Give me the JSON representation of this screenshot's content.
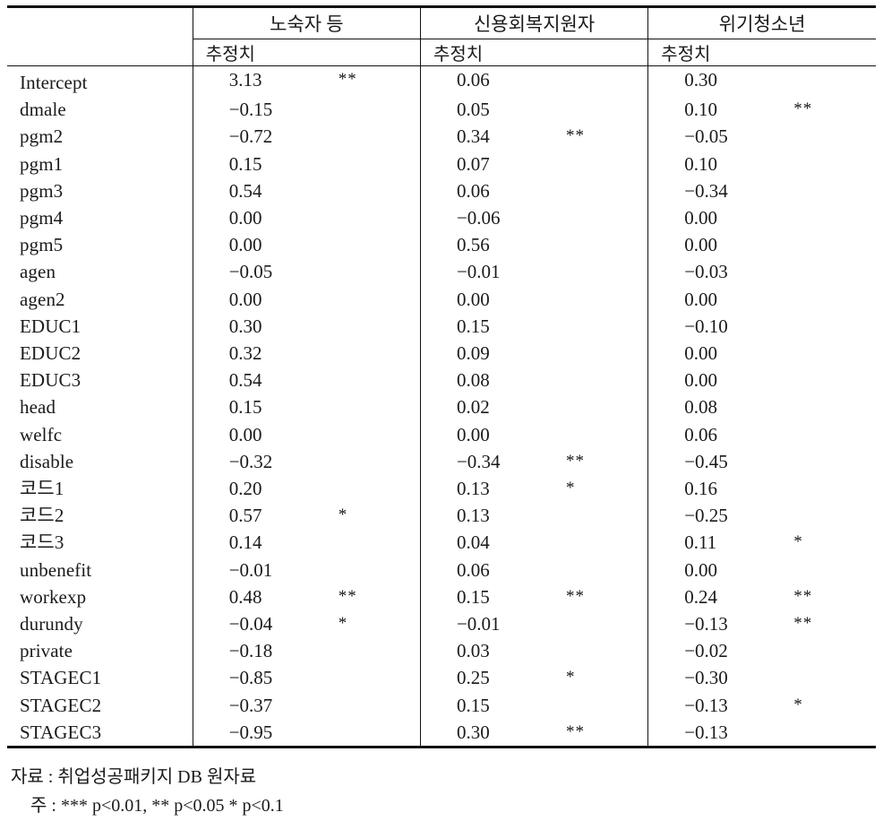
{
  "table": {
    "variable_header": "",
    "groups": [
      {
        "label": "노숙자 등",
        "sub_label": "추정치"
      },
      {
        "label": "신용회복지원자",
        "sub_label": "추정치"
      },
      {
        "label": "위기청소년",
        "sub_label": "추정치"
      }
    ],
    "rows": [
      {
        "variable": "Intercept",
        "c0": "3.13",
        "s0": "**",
        "c1": "0.06",
        "s1": "",
        "c2": "0.30",
        "s2": ""
      },
      {
        "variable": "dmale",
        "c0": "−0.15",
        "s0": "",
        "c1": "0.05",
        "s1": "",
        "c2": "0.10",
        "s2": "**"
      },
      {
        "variable": "pgm2",
        "c0": "−0.72",
        "s0": "",
        "c1": "0.34",
        "s1": "**",
        "c2": "−0.05",
        "s2": ""
      },
      {
        "variable": "pgm1",
        "c0": "0.15",
        "s0": "",
        "c1": "0.07",
        "s1": "",
        "c2": "0.10",
        "s2": ""
      },
      {
        "variable": "pgm3",
        "c0": "0.54",
        "s0": "",
        "c1": "0.06",
        "s1": "",
        "c2": "−0.34",
        "s2": ""
      },
      {
        "variable": "pgm4",
        "c0": "0.00",
        "s0": "",
        "c1": "−0.06",
        "s1": "",
        "c2": "0.00",
        "s2": ""
      },
      {
        "variable": "pgm5",
        "c0": "0.00",
        "s0": "",
        "c1": "0.56",
        "s1": "",
        "c2": "0.00",
        "s2": ""
      },
      {
        "variable": "agen",
        "c0": "−0.05",
        "s0": "",
        "c1": "−0.01",
        "s1": "",
        "c2": "−0.03",
        "s2": ""
      },
      {
        "variable": "agen2",
        "c0": "0.00",
        "s0": "",
        "c1": "0.00",
        "s1": "",
        "c2": "0.00",
        "s2": ""
      },
      {
        "variable": "EDUC1",
        "c0": "0.30",
        "s0": "",
        "c1": "0.15",
        "s1": "",
        "c2": "−0.10",
        "s2": ""
      },
      {
        "variable": "EDUC2",
        "c0": "0.32",
        "s0": "",
        "c1": "0.09",
        "s1": "",
        "c2": "0.00",
        "s2": ""
      },
      {
        "variable": "EDUC3",
        "c0": "0.54",
        "s0": "",
        "c1": "0.08",
        "s1": "",
        "c2": "0.00",
        "s2": ""
      },
      {
        "variable": "head",
        "c0": "0.15",
        "s0": "",
        "c1": "0.02",
        "s1": "",
        "c2": "0.08",
        "s2": ""
      },
      {
        "variable": "welfc",
        "c0": "0.00",
        "s0": "",
        "c1": "0.00",
        "s1": "",
        "c2": "0.06",
        "s2": ""
      },
      {
        "variable": "disable",
        "c0": "−0.32",
        "s0": "",
        "c1": "−0.34",
        "s1": "**",
        "c2": "−0.45",
        "s2": ""
      },
      {
        "variable": "코드1",
        "c0": "0.20",
        "s0": "",
        "c1": "0.13",
        "s1": "*",
        "c2": "0.16",
        "s2": ""
      },
      {
        "variable": "코드2",
        "c0": "0.57",
        "s0": "*",
        "c1": "0.13",
        "s1": "",
        "c2": "−0.25",
        "s2": ""
      },
      {
        "variable": "코드3",
        "c0": "0.14",
        "s0": "",
        "c1": "0.04",
        "s1": "",
        "c2": "0.11",
        "s2": "*"
      },
      {
        "variable": "unbenefit",
        "c0": "−0.01",
        "s0": "",
        "c1": "0.06",
        "s1": "",
        "c2": "0.00",
        "s2": ""
      },
      {
        "variable": "workexp",
        "c0": "0.48",
        "s0": "**",
        "c1": "0.15",
        "s1": "**",
        "c2": "0.24",
        "s2": "**"
      },
      {
        "variable": "durundy",
        "c0": "−0.04",
        "s0": "*",
        "c1": "−0.01",
        "s1": "",
        "c2": "−0.13",
        "s2": "**"
      },
      {
        "variable": "private",
        "c0": "−0.18",
        "s0": "",
        "c1": "0.03",
        "s1": "",
        "c2": "−0.02",
        "s2": ""
      },
      {
        "variable": "STAGEC1",
        "c0": "−0.85",
        "s0": "",
        "c1": "0.25",
        "s1": "*",
        "c2": "−0.30",
        "s2": ""
      },
      {
        "variable": "STAGEC2",
        "c0": "−0.37",
        "s0": "",
        "c1": "0.15",
        "s1": "",
        "c2": "−0.13",
        "s2": "*"
      },
      {
        "variable": "STAGEC3",
        "c0": "−0.95",
        "s0": "",
        "c1": "0.30",
        "s1": "**",
        "c2": "−0.13",
        "s2": ""
      }
    ]
  },
  "notes": {
    "source": "자료 : 취업성공패키지 DB 원자료",
    "significance": "주 : *** p<0.01, ** p<0.05 * p<0.1"
  }
}
